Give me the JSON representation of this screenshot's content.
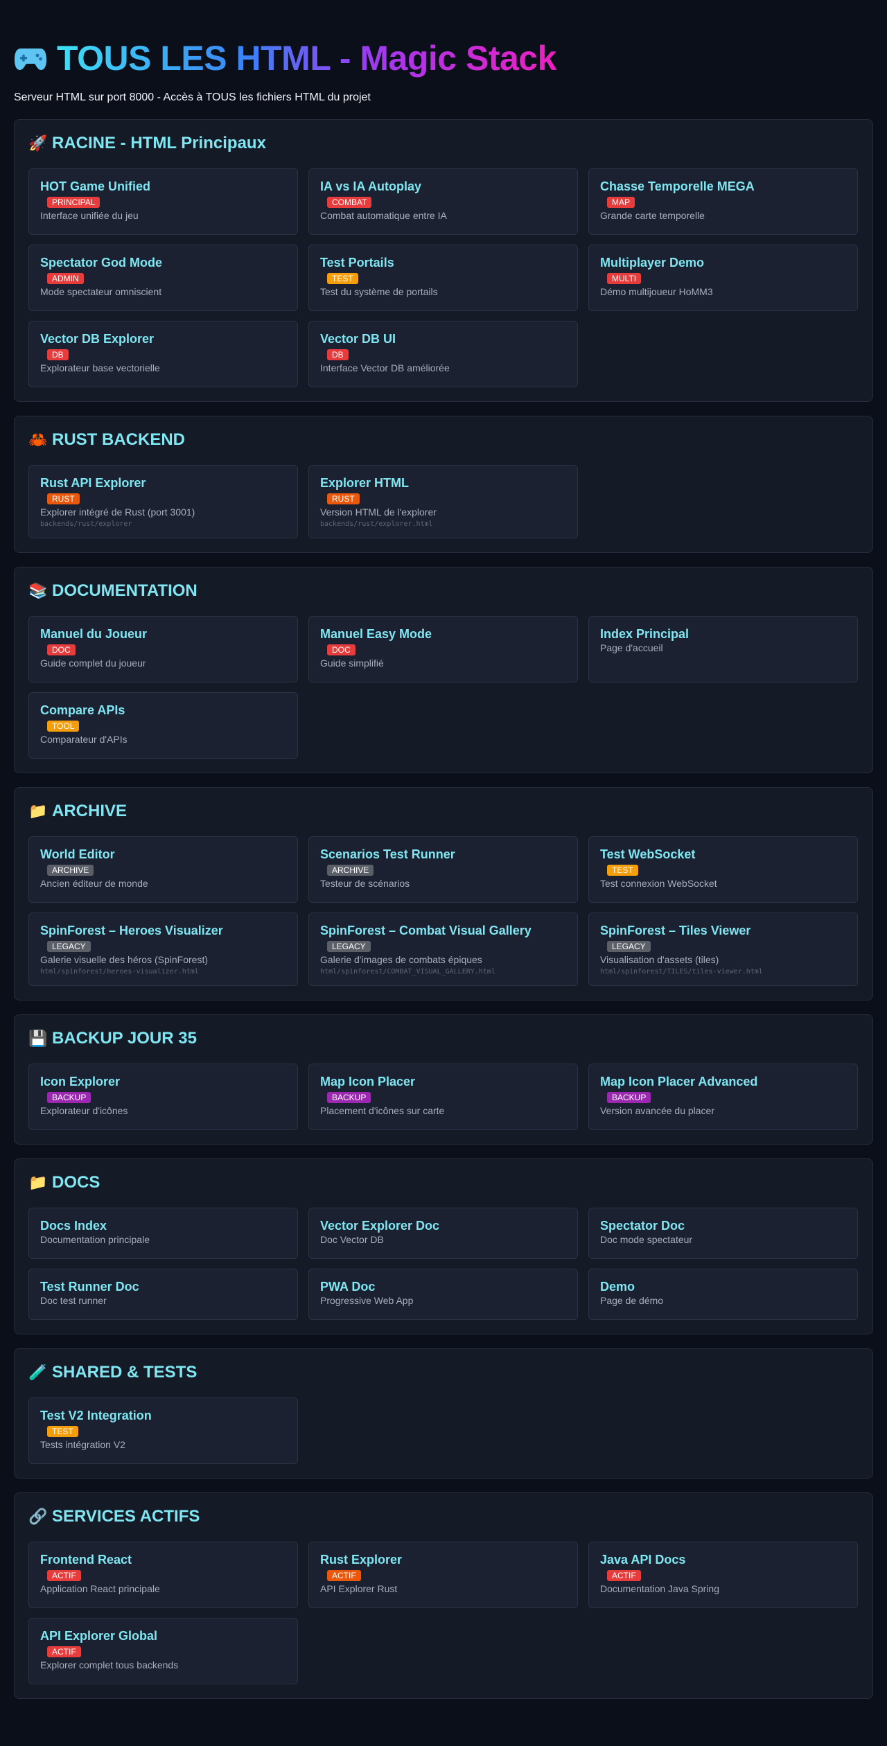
{
  "header": {
    "title": "TOUS LES HTML - Magic Stack",
    "subtitle": "Serveur HTML sur port 8000 - Accès à TOUS les fichiers HTML du projet"
  },
  "sections": [
    {
      "emoji": "🚀",
      "title": "RACINE - HTML Principaux",
      "cards": [
        {
          "title": "HOT Game Unified",
          "badge": "PRINCIPAL",
          "badge_color": "#e83b3b",
          "desc": "Interface unifiée du jeu"
        },
        {
          "title": "IA vs IA Autoplay",
          "badge": "COMBAT",
          "badge_color": "#e83b3b",
          "desc": "Combat automatique entre IA"
        },
        {
          "title": "Chasse Temporelle MEGA",
          "badge": "MAP",
          "badge_color": "#e83b3b",
          "desc": "Grande carte temporelle"
        },
        {
          "title": "Spectator God Mode",
          "badge": "ADMIN",
          "badge_color": "#e83b3b",
          "desc": "Mode spectateur omniscient"
        },
        {
          "title": "Test Portails",
          "badge": "TEST",
          "badge_color": "#f59e0b",
          "desc": "Test du système de portails"
        },
        {
          "title": "Multiplayer Demo",
          "badge": "MULTI",
          "badge_color": "#e83b3b",
          "desc": "Démo multijoueur HoMM3"
        },
        {
          "title": "Vector DB Explorer",
          "badge": "DB",
          "badge_color": "#e83b3b",
          "desc": "Explorateur base vectorielle"
        },
        {
          "title": "Vector DB UI",
          "badge": "DB",
          "badge_color": "#e83b3b",
          "desc": "Interface Vector DB améliorée"
        }
      ]
    },
    {
      "emoji": "🦀",
      "title": "RUST BACKEND",
      "cards": [
        {
          "title": "Rust API Explorer",
          "badge": "RUST",
          "badge_color": "#ea580c",
          "desc": "Explorer intégré de Rust (port 3001)",
          "path": "backends/rust/explorer"
        },
        {
          "title": "Explorer HTML",
          "badge": "RUST",
          "badge_color": "#ea580c",
          "desc": "Version HTML de l'explorer",
          "path": "backends/rust/explorer.html"
        }
      ]
    },
    {
      "emoji": "📚",
      "title": "DOCUMENTATION",
      "cards": [
        {
          "title": "Manuel du Joueur",
          "badge": "DOC",
          "badge_color": "#e83b3b",
          "desc": "Guide complet du joueur"
        },
        {
          "title": "Manuel Easy Mode",
          "badge": "DOC",
          "badge_color": "#e83b3b",
          "desc": "Guide simplifié"
        },
        {
          "title": "Index Principal",
          "desc": "Page d'accueil"
        },
        {
          "title": "Compare APIs",
          "badge": "TOOL",
          "badge_color": "#f59e0b",
          "desc": "Comparateur d'APIs"
        }
      ]
    },
    {
      "emoji": "📁",
      "title": "ARCHIVE",
      "cards": [
        {
          "title": "World Editor",
          "badge": "ARCHIVE",
          "badge_color": "#5b5f68",
          "desc": "Ancien éditeur de monde"
        },
        {
          "title": "Scenarios Test Runner",
          "badge": "ARCHIVE",
          "badge_color": "#5b5f68",
          "desc": "Testeur de scénarios"
        },
        {
          "title": "Test WebSocket",
          "badge": "TEST",
          "badge_color": "#f59e0b",
          "desc": "Test connexion WebSocket"
        },
        {
          "title": "SpinForest – Heroes Visualizer",
          "badge": "LEGACY",
          "badge_color": "#5b5f68",
          "desc": "Galerie visuelle des héros (SpinForest)",
          "path": "html/spinforest/heroes-visualizer.html"
        },
        {
          "title": "SpinForest – Combat Visual Gallery",
          "badge": "LEGACY",
          "badge_color": "#5b5f68",
          "desc": "Galerie d'images de combats épiques",
          "path": "html/spinforest/COMBAT_VISUAL_GALLERY.html"
        },
        {
          "title": "SpinForest – Tiles Viewer",
          "badge": "LEGACY",
          "badge_color": "#5b5f68",
          "desc": "Visualisation d'assets (tiles)",
          "path": "html/spinforest/TILES/tiles-viewer.html"
        }
      ]
    },
    {
      "emoji": "💾",
      "title": "BACKUP JOUR 35",
      "cards": [
        {
          "title": "Icon Explorer",
          "badge": "BACKUP",
          "badge_color": "#9c27b0",
          "desc": "Explorateur d'icônes"
        },
        {
          "title": "Map Icon Placer",
          "badge": "BACKUP",
          "badge_color": "#9c27b0",
          "desc": "Placement d'icônes sur carte"
        },
        {
          "title": "Map Icon Placer Advanced",
          "badge": "BACKUP",
          "badge_color": "#9c27b0",
          "desc": "Version avancée du placer"
        }
      ]
    },
    {
      "emoji": "📁",
      "title": "DOCS",
      "cards": [
        {
          "title": "Docs Index",
          "desc": "Documentation principale"
        },
        {
          "title": "Vector Explorer Doc",
          "desc": "Doc Vector DB"
        },
        {
          "title": "Spectator Doc",
          "desc": "Doc mode spectateur"
        },
        {
          "title": "Test Runner Doc",
          "desc": "Doc test runner"
        },
        {
          "title": "PWA Doc",
          "desc": "Progressive Web App"
        },
        {
          "title": "Demo",
          "desc": "Page de démo"
        }
      ]
    },
    {
      "emoji": "🧪",
      "title": "SHARED & TESTS",
      "cards": [
        {
          "title": "Test V2 Integration",
          "badge": "TEST",
          "badge_color": "#f59e0b",
          "desc": "Tests intégration V2"
        }
      ]
    },
    {
      "emoji": "🔗",
      "title": "SERVICES ACTIFS",
      "cards": [
        {
          "title": "Frontend React",
          "badge": "ACTIF",
          "badge_color": "#e83b3b",
          "desc": "Application React principale"
        },
        {
          "title": "Rust Explorer",
          "badge": "ACTIF",
          "badge_color": "#ea580c",
          "desc": "API Explorer Rust"
        },
        {
          "title": "Java API Docs",
          "badge": "ACTIF",
          "badge_color": "#e83b3b",
          "desc": "Documentation Java Spring"
        },
        {
          "title": "API Explorer Global",
          "badge": "ACTIF",
          "badge_color": "#e83b3b",
          "desc": "Explorer complet tous backends"
        }
      ]
    }
  ]
}
